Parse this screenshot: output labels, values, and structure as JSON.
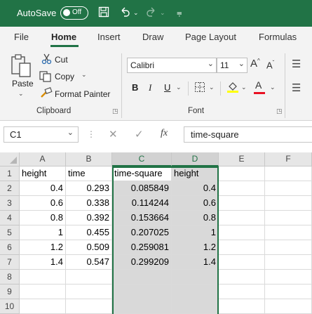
{
  "titlebar": {
    "autosave_label": "AutoSave",
    "toggle_state": "Off"
  },
  "tabs": [
    "File",
    "Home",
    "Insert",
    "Draw",
    "Page Layout",
    "Formulas"
  ],
  "ribbon": {
    "clipboard": {
      "paste_label": "Paste",
      "cut_label": "Cut",
      "copy_label": "Copy",
      "format_painter_label": "Format Painter",
      "group_label": "Clipboard"
    },
    "font": {
      "font_name": "Calibri",
      "font_size": "11",
      "group_label": "Font",
      "bold": "B",
      "italic": "I",
      "underline": "U",
      "font_color_glyph": "A"
    }
  },
  "formula_bar": {
    "name_box": "C1",
    "fx_label": "fx",
    "content": "time-square"
  },
  "grid": {
    "columns": [
      "A",
      "B",
      "C",
      "D",
      "E",
      "F"
    ],
    "rows": [
      "1",
      "2",
      "3",
      "4",
      "5",
      "6",
      "7",
      "8",
      "9",
      "10"
    ],
    "headers": [
      "height",
      "time",
      "time-square",
      "height"
    ],
    "data": [
      [
        "0.4",
        "0.293",
        "0.085849",
        "0.4"
      ],
      [
        "0.6",
        "0.338",
        "0.114244",
        "0.6"
      ],
      [
        "0.8",
        "0.392",
        "0.153664",
        "0.8"
      ],
      [
        "1",
        "0.455",
        "0.207025",
        "1"
      ],
      [
        "1.2",
        "0.509",
        "0.259081",
        "1.2"
      ],
      [
        "1.4",
        "0.547",
        "0.299209",
        "1.4"
      ]
    ]
  },
  "colors": {
    "accent": "#217346",
    "selection_fill": "#d9d9d9",
    "font_color_bar": "#e81123",
    "highlight_bar": "#ffff00"
  }
}
